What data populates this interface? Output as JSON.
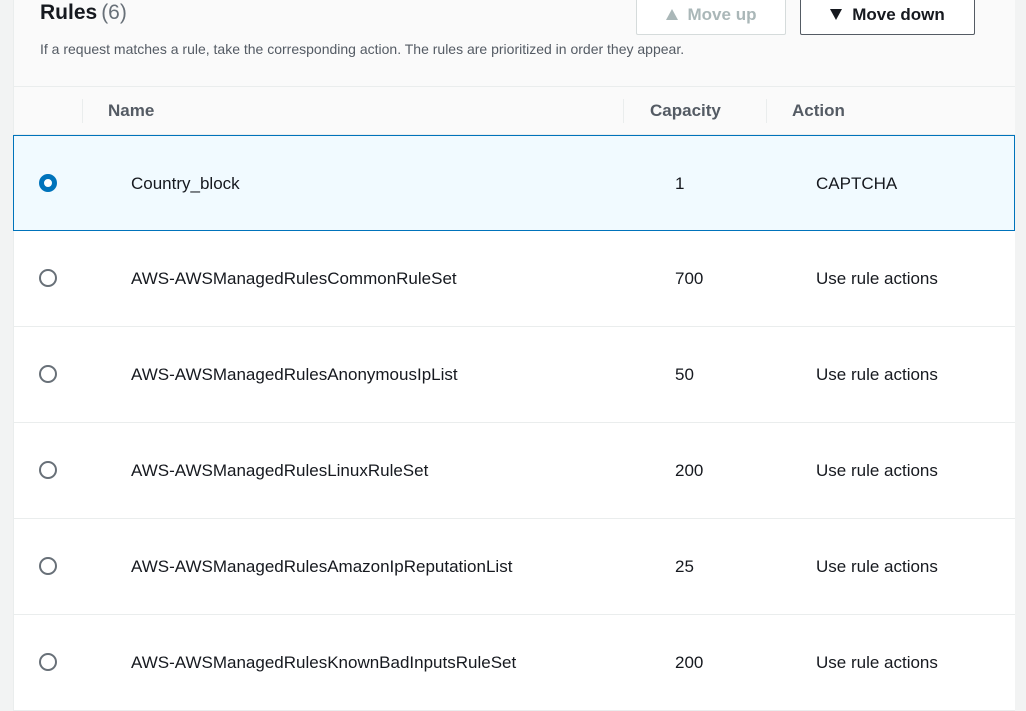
{
  "header": {
    "title": "Rules",
    "count": "(6)",
    "description": "If a request matches a rule, take the corresponding action. The rules are prioritized in order they appear.",
    "move_up_label": "Move up",
    "move_down_label": "Move down"
  },
  "table": {
    "columns": {
      "name": "Name",
      "capacity": "Capacity",
      "action": "Action"
    },
    "rows": [
      {
        "name": "Country_block",
        "capacity": "1",
        "action": "CAPTCHA",
        "selected": true
      },
      {
        "name": "AWS-AWSManagedRulesCommonRuleSet",
        "capacity": "700",
        "action": "Use rule actions",
        "selected": false
      },
      {
        "name": "AWS-AWSManagedRulesAnonymousIpList",
        "capacity": "50",
        "action": "Use rule actions",
        "selected": false
      },
      {
        "name": "AWS-AWSManagedRulesLinuxRuleSet",
        "capacity": "200",
        "action": "Use rule actions",
        "selected": false
      },
      {
        "name": "AWS-AWSManagedRulesAmazonIpReputationList",
        "capacity": "25",
        "action": "Use rule actions",
        "selected": false
      },
      {
        "name": "AWS-AWSManagedRulesKnownBadInputsRuleSet",
        "capacity": "200",
        "action": "Use rule actions",
        "selected": false
      }
    ]
  },
  "colors": {
    "accent": "#0073bb",
    "selected_row_bg": "#f1faff",
    "disabled_text": "#aab7b8"
  },
  "icons": {
    "move_up": "triangle-up-icon",
    "move_down": "triangle-down-icon"
  }
}
